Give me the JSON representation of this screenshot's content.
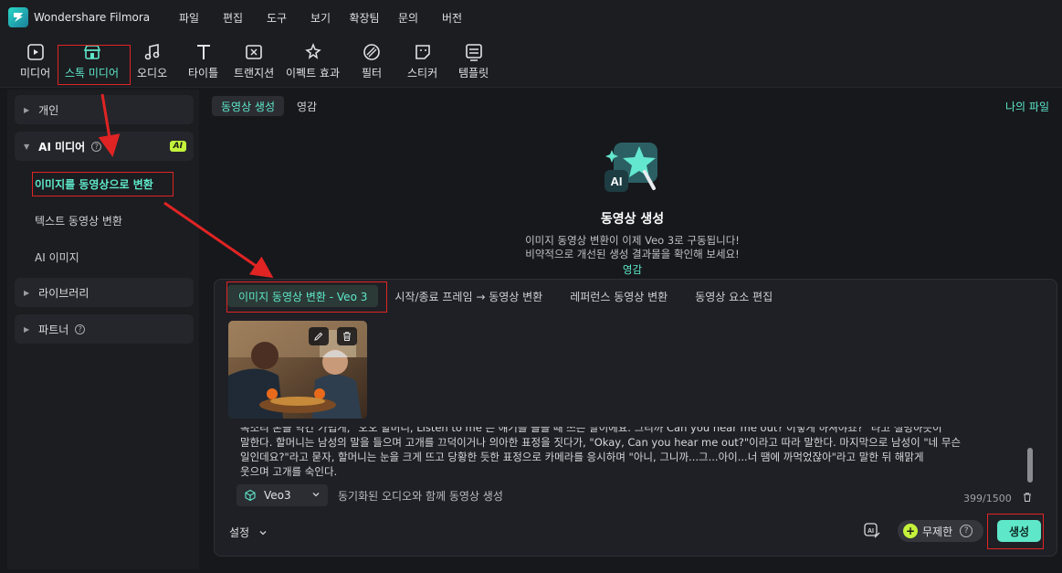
{
  "app": {
    "title": "Wondershare Filmora"
  },
  "menu": [
    "파일",
    "편집",
    "도구",
    "보기",
    "확장팀",
    "문의",
    "버전"
  ],
  "toolbar": [
    {
      "label": "미디어",
      "icon": "media-icon"
    },
    {
      "label": "스톡 미디어",
      "icon": "stock-media-icon",
      "active": true
    },
    {
      "label": "오디오",
      "icon": "audio-icon"
    },
    {
      "label": "타이틀",
      "icon": "title-icon"
    },
    {
      "label": "트랜지션",
      "icon": "transition-icon"
    },
    {
      "label": "이펙트 효과",
      "icon": "effects-icon"
    },
    {
      "label": "필터",
      "icon": "filter-icon"
    },
    {
      "label": "스티커",
      "icon": "sticker-icon"
    },
    {
      "label": "템플릿",
      "icon": "template-icon"
    }
  ],
  "sidebar": {
    "groups": [
      {
        "label": "개인"
      },
      {
        "label": "AI 미디어",
        "badge": "AI"
      },
      {
        "label": "라이브러리"
      },
      {
        "label": "파트너"
      }
    ],
    "subitems": [
      {
        "label": "이미지를 동영상으로 변환",
        "active": true
      },
      {
        "label": "텍스트 동영상 변환"
      },
      {
        "label": "AI 이미지"
      }
    ]
  },
  "main": {
    "tabs": [
      "동영상 생성",
      "영감"
    ],
    "my_files": "나의 파일",
    "hero": {
      "icon_badge": "AI",
      "title": "동영상 생성",
      "desc_line1": "이미지 동영상 변환이 이제 Veo 3로 구동됩니다!",
      "desc_line2": "비약적으로 개선된 생성 결과물을 확인해 보세요!",
      "link": "영감"
    },
    "panel_tabs": [
      "이미지 동영상 변환 - Veo 3",
      "시작/종료 프레임 → 동영상 변환",
      "레퍼런스 동영상 변환",
      "동영상 요소 편집"
    ],
    "prompt_lines": [
      "목소리 톤을 약간 가볍게, \"오오 할머니, Listen to me 는 얘기를 들을 때 쓰는 말이에요. 그리까 Can you hear me out? 이렇게 하셔야죠?\" 라고 설명하듯이",
      "말한다. 할머니는 남성의 말을 들으며 고개를 끄덕이거나 의아한 표정을 짓다가, \"Okay, Can you hear me out?\"이라고 따라 말한다. 마지막으로 남성이 \"네 무슨",
      "일인데요?\"라고 묻자, 할머니는 눈을 크게 뜨고 당황한 듯한 표정으로 카메라를 응시하며 \"아니, 그니까...그...아이...너 땜에 까먹었잖아\"라고 말한 뒤 해맑게",
      "웃으며 고개를 숙인다."
    ],
    "model": "Veo3",
    "sync_label": "동기화된 오디오와 함께 동영상 생성",
    "char_count": "399/1500",
    "settings_label": "설정",
    "free_label": "무제한",
    "generate_label": "생성"
  },
  "colors": {
    "accent": "#5ee8c9",
    "badge": "#c4f23b",
    "highlight": "#e02424"
  }
}
